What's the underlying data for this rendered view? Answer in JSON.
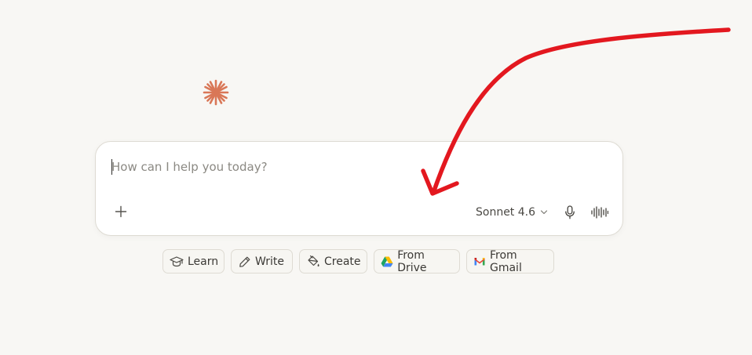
{
  "composer": {
    "placeholder": "How can I help you today?",
    "value": "",
    "model_label": "Sonnet 4.6"
  },
  "chips": [
    {
      "label": "Learn",
      "icon": "graduation-cap-icon"
    },
    {
      "label": "Write",
      "icon": "pencil-icon"
    },
    {
      "label": "Create",
      "icon": "paint-bucket-icon"
    },
    {
      "label": "From Drive",
      "icon": "google-drive-icon"
    },
    {
      "label": "From Gmail",
      "icon": "gmail-icon"
    }
  ],
  "icons": {
    "logo": "sparkle-logo-icon",
    "add": "plus-icon",
    "model_dropdown": "chevron-down-icon",
    "mic": "microphone-icon",
    "voice": "waveform-icon"
  },
  "colors": {
    "background": "#f8f7f4",
    "logo": "#d97757",
    "annotation_arrow": "#e3181f",
    "composer_border": "#dedbd3"
  }
}
